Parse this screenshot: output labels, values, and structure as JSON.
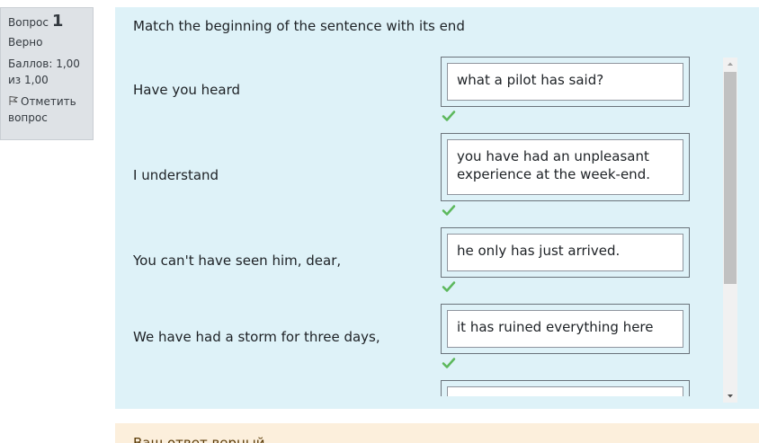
{
  "info": {
    "question_label": "Вопрос",
    "question_number": "1",
    "state": "Верно",
    "grade": "Баллов: 1,00 из 1,00",
    "flag_label": "Отметить вопрос"
  },
  "question": {
    "text": "Match the beginning of the sentence with its end",
    "rows": [
      {
        "stem": "Have you heard",
        "answer": "what a pilot has said?",
        "correct": true
      },
      {
        "stem": "I understand",
        "answer": "you have had an unpleasant experience at the week-end.",
        "correct": true
      },
      {
        "stem": "You can't have seen him, dear,",
        "answer": "he only has just arrived.",
        "correct": true
      },
      {
        "stem": "We have had a storm for three days,",
        "answer": "it has ruined everything here",
        "correct": true
      },
      {
        "stem": "",
        "answer": "",
        "correct": false
      }
    ]
  },
  "colors": {
    "formulation_bg": "#def2f8",
    "outcome_bg": "#fcefdc",
    "correct_check": "#5cb85c"
  },
  "icons": {
    "flag": "flag-icon",
    "check": "check-icon",
    "scroll_up": "scroll-up-icon",
    "scroll_down": "scroll-down-icon"
  },
  "outcome": {
    "text": "Ваш ответ верный."
  }
}
